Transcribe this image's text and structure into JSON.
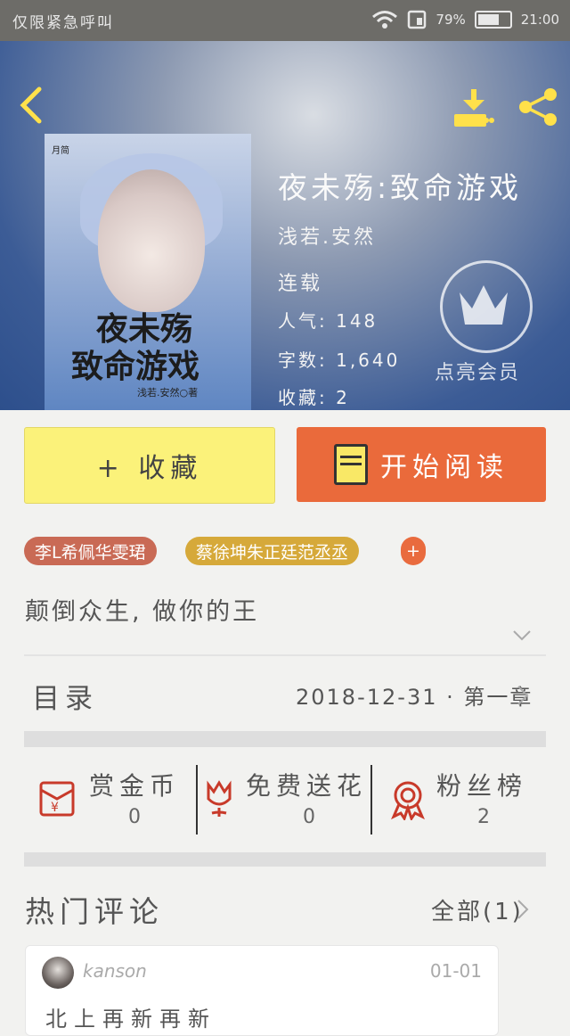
{
  "status_bar": {
    "carrier": "仅限紧急呼叫",
    "battery_percent": "79%",
    "battery_level": 0.79,
    "time": "21:00"
  },
  "toolbar": {
    "back_icon": "chevron-left-icon",
    "download_icon": "download-icon",
    "share_icon": "share-icon"
  },
  "book": {
    "cover": {
      "title_line1": "夜未殇",
      "title_line2": "致命游戏",
      "author": "浅若.安然○著",
      "corner_tag": "月简"
    },
    "title": "夜未殇:致命游戏",
    "author": "浅若.安然",
    "status": "连载",
    "popularity": "人气: 148",
    "word_count": "字数: 1,640",
    "favorites": "收藏: 2",
    "vip_label": "点亮会员"
  },
  "actions": {
    "favorite_label": "+ 收藏",
    "read_label": "开始阅读"
  },
  "tags": [
    "李L希佩华雯珺",
    "蔡徐坤朱正廷范丞丞",
    "+"
  ],
  "intro": "颠倒众生, 做你的王",
  "toc": {
    "label": "目录",
    "latest": "2018-12-31 · 第一章"
  },
  "stats": [
    {
      "label": "赏金币",
      "value": "0",
      "icon": "red-envelope-icon"
    },
    {
      "label": "免费送花",
      "value": "0",
      "icon": "flower-icon"
    },
    {
      "label": "粉丝榜",
      "value": "2",
      "icon": "medal-icon"
    }
  ],
  "comments": {
    "title": "热门评论",
    "all_label": "全部(1)",
    "items": [
      {
        "user": "kanson",
        "date": "01-01",
        "text": "北上再新再新"
      }
    ]
  },
  "colors": {
    "accent_orange": "#ea6a3b",
    "favorite_yellow": "#fbf27a",
    "icon_yellow": "#ffe14a",
    "tag_red": "#c96a55",
    "tag_gold": "#d6a93a",
    "icon_red": "#c83a2a"
  }
}
